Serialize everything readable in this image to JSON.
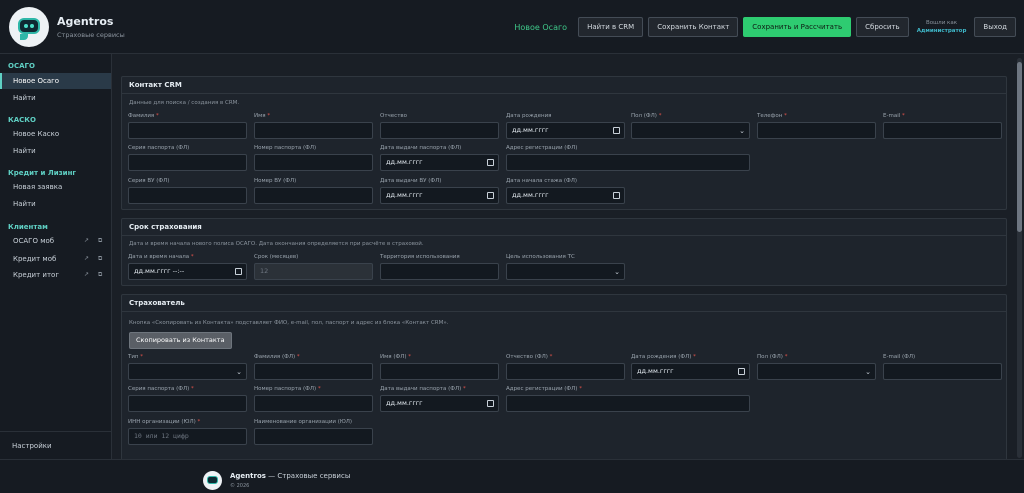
{
  "header": {
    "brand_name": "Agentros",
    "brand_sub": "Страховые сервисы",
    "nav_link": "Новое Осаго",
    "btn_find_crm": "Найти в CRM",
    "btn_save_contact": "Сохранить Контакт",
    "btn_save_calc": "Сохранить и Рассчитать",
    "btn_reset": "Сбросить",
    "logged_as": "Вошли как",
    "user_name": "Администратор",
    "btn_logout": "Выход"
  },
  "sidebar": {
    "sec_osago": "ОСАГО",
    "osago_new": "Новое Осаго",
    "osago_find": "Найти",
    "sec_kasko": "КАСКО",
    "kasko_new": "Новое Каско",
    "kasko_find": "Найти",
    "sec_credit": "Кредит и Лизинг",
    "credit_new": "Новая заявка",
    "credit_find": "Найти",
    "sec_clients": "Клиентам",
    "client_osago": "ОСАГО моб",
    "client_credit": "Кредит моб",
    "client_credit_total": "Кредит итог",
    "settings": "Настройки"
  },
  "crm": {
    "title": "Контакт CRM",
    "note": "Данные для поиска / создания в CRM.",
    "surname": "Фамилия",
    "name": "Имя",
    "patronymic": "Отчество",
    "birth_date": "Дата рождения",
    "gender": "Пол (ФЛ)",
    "phone": "Телефон",
    "email": "E-mail",
    "passport_series": "Серия паспорта (ФЛ)",
    "passport_number": "Номер паспорта (ФЛ)",
    "passport_date": "Дата выдачи паспорта (ФЛ)",
    "reg_address": "Адрес регистрации (ФЛ)",
    "license_series": "Серия ВУ (ФЛ)",
    "license_number": "Номер ВУ (ФЛ)",
    "license_date": "Дата выдачи ВУ (ФЛ)",
    "experience_date": "Дата начала стажа (ФЛ)",
    "date_placeholder": "дд.мм.гггг"
  },
  "term": {
    "title": "Срок страхования",
    "note": "Дата и время начала нового полиса ОСАГО. Дата окончания определяется при расчёте в страховой.",
    "start": "Дата и время начала",
    "start_value": "дд.мм.гггг --:--",
    "months": "Срок (месяцев)",
    "months_value": "12",
    "territory": "Территория использования",
    "purpose": "Цель использования ТС"
  },
  "insurer": {
    "title": "Страхователь",
    "note": "Кнопка «Скопировать из Контакта» подставляет ФИО, e-mail, пол, паспорт и адрес из блока «Контакт CRM».",
    "copy_btn": "Скопировать из Контакта",
    "type": "Тип",
    "surname": "Фамилия (ФЛ)",
    "name": "Имя (ФЛ)",
    "patronymic": "Отчество (ФЛ)",
    "birth_date": "Дата рождения (ФЛ)",
    "gender": "Пол (ФЛ)",
    "email": "E-mail (ФЛ)",
    "passport_series": "Серия паспорта (ФЛ)",
    "passport_number": "Номер паспорта (ФЛ)",
    "passport_date": "Дата выдачи паспорта (ФЛ)",
    "reg_address": "Адрес регистрации (ФЛ)",
    "inn": "ИНН организации (ЮЛ)",
    "inn_placeholder": "10 или 12 цифр",
    "org_name": "Наименование организации (ЮЛ)",
    "date_placeholder": "дд.мм.гггг"
  },
  "footer": {
    "brand": "Agentros",
    "tagline": " — Страховые сервисы",
    "copyright": "© 2026"
  },
  "icons": {
    "external": "external-link-icon",
    "copy": "copy-icon"
  }
}
